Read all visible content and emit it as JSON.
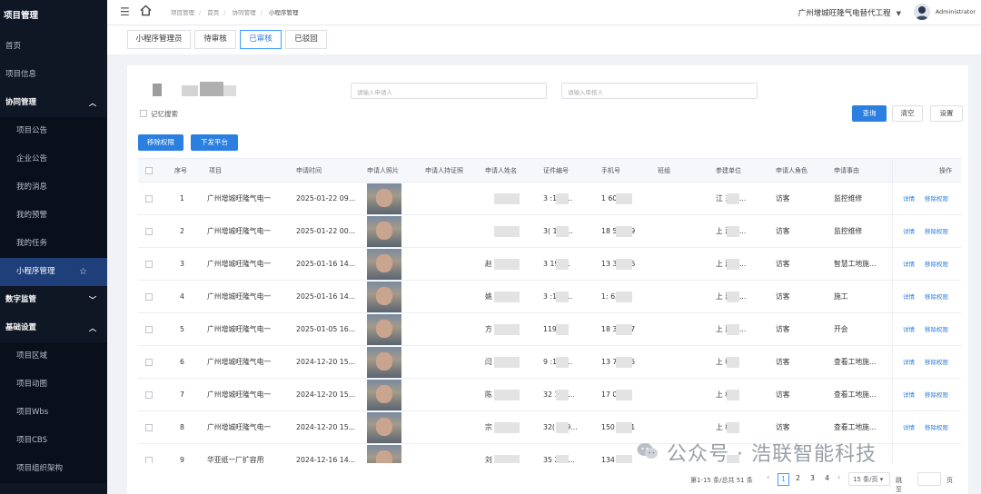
{
  "sidebar": {
    "title": "项目管理",
    "items": [
      {
        "label": "首页",
        "type": "item"
      },
      {
        "label": "项目信息",
        "type": "item"
      },
      {
        "label": "协同管理",
        "type": "group",
        "caret": "^"
      },
      {
        "label": "项目公告",
        "type": "child"
      },
      {
        "label": "企业公告",
        "type": "child"
      },
      {
        "label": "我的消息",
        "type": "child"
      },
      {
        "label": "我的预警",
        "type": "child"
      },
      {
        "label": "我的任务",
        "type": "child"
      },
      {
        "label": "小程序管理",
        "type": "child-active"
      },
      {
        "label": "数字监管",
        "type": "group-collapsed",
        "caret": "v"
      },
      {
        "label": "基础设置",
        "type": "group",
        "caret": "^"
      },
      {
        "label": "项目区域",
        "type": "child"
      },
      {
        "label": "项目动图",
        "type": "child"
      },
      {
        "label": "项目Wbs",
        "type": "child"
      },
      {
        "label": "项目CBS",
        "type": "child"
      },
      {
        "label": "项目组织架构",
        "type": "child"
      }
    ]
  },
  "header": {
    "breadcrumb": [
      "项目管理",
      "首页",
      "协同管理",
      "小程序管理"
    ],
    "company": "广州增城旺隆气电替代工程",
    "user": "Administrator"
  },
  "tabs": [
    {
      "label": "小程序管理员"
    },
    {
      "label": "待审核"
    },
    {
      "label": "已审核"
    },
    {
      "label": "已驳回"
    }
  ],
  "filters": {
    "applicant_placeholder": "请输入申请人",
    "reviewer_placeholder": "请输入审核人",
    "remember_label": "记忆搜索",
    "query_label": "查询",
    "clear_label": "清空",
    "settings_label": "设置",
    "move_perm_label": "移除权限",
    "dispatch_label": "下发平台"
  },
  "table": {
    "columns": [
      "序号",
      "项目",
      "申请时间",
      "申请人照片",
      "申请人持证照",
      "申请人姓名",
      "证件编号",
      "手机号",
      "班组",
      "参建单位",
      "申请人角色",
      "申请事由",
      "操作"
    ],
    "rows": [
      {
        "no": "1",
        "project": "广州增城旺隆气电一",
        "time": "2025-01-22 09...",
        "name": "",
        "id": "3   :199...",
        "phone": "1       6046",
        "unit": "江    东钢...",
        "role": "访客",
        "reason": "监控维修"
      },
      {
        "no": "2",
        "project": "广州增城旺隆气电一",
        "time": "2025-01-22 00...",
        "name": "",
        "id": "3(    199...",
        "phone": "18     58889",
        "unit": "上    建工...",
        "role": "访客",
        "reason": "监控维修"
      },
      {
        "no": "3",
        "project": "广州增城旺隆气电一",
        "time": "2025-01-16 14...",
        "name": "赵",
        "id": "3     197...",
        "phone": "13     37076",
        "unit": "上    建工...",
        "role": "访客",
        "reason": "智慧工地施..."
      },
      {
        "no": "4",
        "project": "广州增城旺隆气电一",
        "time": "2025-01-16 14...",
        "name": "姚",
        "id": "3    :199...",
        "phone": "1:     62192",
        "unit": "上    建工...",
        "role": "访客",
        "reason": "施工"
      },
      {
        "no": "5",
        "project": "广州增城旺隆气电一",
        "time": "2025-01-05 16...",
        "name": "方",
        "id": "     1198...",
        "phone": "18     30417",
        "unit": "上    建料...",
        "role": "访客",
        "reason": "开会"
      },
      {
        "no": "6",
        "project": "广州增城旺隆气电一",
        "time": "2024-12-20 15...",
        "name": "闫",
        "id": "9    :198...",
        "phone": "13     73375",
        "unit": "上    桥...",
        "role": "访客",
        "reason": "查看工地施..."
      },
      {
        "no": "7",
        "project": "广州增城旺隆气电一",
        "time": "2024-12-20 15...",
        "name": "陈",
        "id": "32     199...",
        "phone": "17     0816",
        "unit": "上    桥...",
        "role": "访客",
        "reason": "查看工地施..."
      },
      {
        "no": "8",
        "project": "广州增城旺隆气电一",
        "time": "2024-12-20 15...",
        "name": "宗",
        "id": "32(    199...",
        "phone": "150     3071",
        "unit": "上    桥...",
        "role": "访客",
        "reason": "查看工地施..."
      },
      {
        "no": "9",
        "project": "华亚纸一厂扩容用",
        "time": "2024-12-16 14...",
        "name": "刘",
        "id": "35     200...",
        "phone": "134     ",
        "unit": "",
        "role": "",
        "reason": ""
      }
    ],
    "actions": {
      "detail": "详情",
      "remove": "移除权限"
    }
  },
  "pagination": {
    "total": "第1-15 条/总共 51 条",
    "pages": [
      "1",
      "2",
      "3",
      "4"
    ],
    "current": "1",
    "size": "15 条/页",
    "jump": "跳至",
    "page_suffix": "页"
  },
  "watermark": "公众号 · 浩联智能科技",
  "colors": {
    "sidebar_bg": "#0f1624",
    "active_item": "#1f3f7a",
    "primary": "#2a7fe0"
  }
}
